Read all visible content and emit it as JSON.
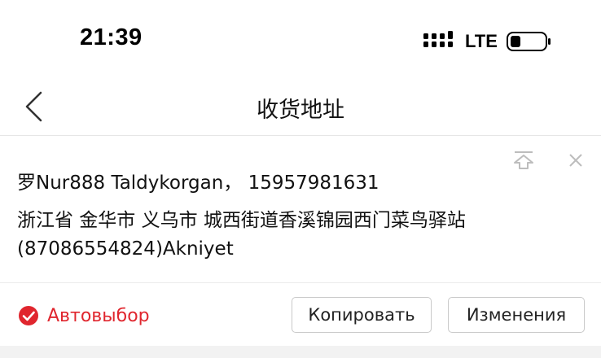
{
  "status_bar": {
    "time": "21:39",
    "network": "LTE",
    "icons": [
      "signal-icon",
      "battery-icon"
    ]
  },
  "nav": {
    "title": "收货地址",
    "back_icon": "chevron-left-icon"
  },
  "address_card": {
    "line1": "罗Nur888 Taldykorgan， 15957981631",
    "line2": "浙江省 金华市 义乌市 城西街道香溪锦园西门菜鸟驿站(87086554824)Akniyet",
    "pin_icon": "pin-to-top-icon",
    "close_icon": "close-icon"
  },
  "actions": {
    "auto_select_label": "Автовыбор",
    "copy_label": "Копировать",
    "edit_label": "Изменения"
  },
  "colors": {
    "accent": "#e0262e",
    "text": "#111111",
    "divider": "#e6e6e6",
    "button_border": "#c9c9c9"
  }
}
